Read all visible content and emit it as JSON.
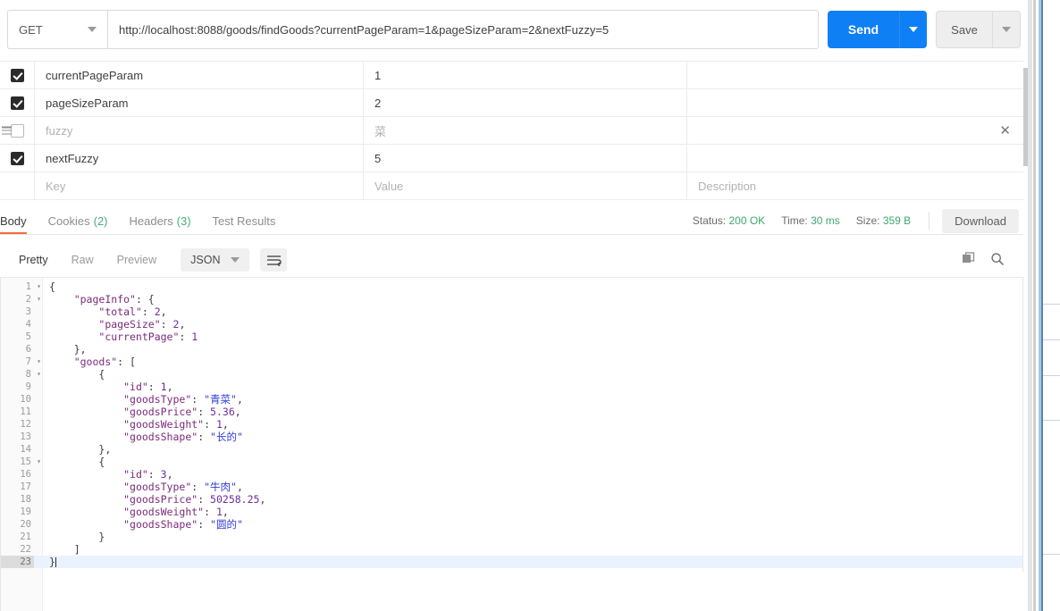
{
  "request": {
    "method": "GET",
    "url": "http://localhost:8088/goods/findGoods?currentPageParam=1&pageSizeParam=2&nextFuzzy=5",
    "send_label": "Send",
    "save_label": "Save"
  },
  "params": {
    "placeholder_key": "Key",
    "placeholder_value": "Value",
    "placeholder_description": "Description",
    "rows": [
      {
        "checked": true,
        "key": "currentPageParam",
        "value": "1",
        "description": "",
        "removable": false
      },
      {
        "checked": true,
        "key": "pageSizeParam",
        "value": "2",
        "description": "",
        "removable": false
      },
      {
        "checked": false,
        "key": "fuzzy",
        "value": "菜",
        "description": "",
        "removable": true
      },
      {
        "checked": true,
        "key": "nextFuzzy",
        "value": "5",
        "description": "",
        "removable": false
      }
    ]
  },
  "response": {
    "tabs": [
      {
        "label": "Body",
        "count": "",
        "active": true
      },
      {
        "label": "Cookies",
        "count": "(2)",
        "active": false
      },
      {
        "label": "Headers",
        "count": "(3)",
        "active": false
      },
      {
        "label": "Test Results",
        "count": "",
        "active": false
      }
    ],
    "status_label": "Status:",
    "status_value": "200 OK",
    "time_label": "Time:",
    "time_value": "30 ms",
    "size_label": "Size:",
    "size_value": "359 B",
    "download_label": "Download",
    "status_color": "#3fa86f"
  },
  "viewer": {
    "modes": [
      {
        "label": "Pretty",
        "active": true
      },
      {
        "label": "Raw",
        "active": false
      },
      {
        "label": "Preview",
        "active": false
      }
    ],
    "language": "JSON",
    "wrap_icon": "wrap-lines-icon",
    "copy_icon": "copy-icon",
    "search_icon": "search-icon"
  },
  "body": {
    "lines": [
      {
        "n": "1",
        "fold": "▾",
        "indent": 0,
        "segments": [
          {
            "t": "{",
            "c": "punc"
          }
        ]
      },
      {
        "n": "2",
        "fold": "▾",
        "indent": 1,
        "segments": [
          {
            "t": "\"pageInfo\"",
            "c": "key"
          },
          {
            "t": ": {",
            "c": "punc"
          }
        ]
      },
      {
        "n": "3",
        "fold": "",
        "indent": 2,
        "segments": [
          {
            "t": "\"total\"",
            "c": "key"
          },
          {
            "t": ": ",
            "c": "punc"
          },
          {
            "t": "2",
            "c": "num"
          },
          {
            "t": ",",
            "c": "punc"
          }
        ]
      },
      {
        "n": "4",
        "fold": "",
        "indent": 2,
        "segments": [
          {
            "t": "\"pageSize\"",
            "c": "key"
          },
          {
            "t": ": ",
            "c": "punc"
          },
          {
            "t": "2",
            "c": "num"
          },
          {
            "t": ",",
            "c": "punc"
          }
        ]
      },
      {
        "n": "5",
        "fold": "",
        "indent": 2,
        "segments": [
          {
            "t": "\"currentPage\"",
            "c": "key"
          },
          {
            "t": ": ",
            "c": "punc"
          },
          {
            "t": "1",
            "c": "num"
          }
        ]
      },
      {
        "n": "6",
        "fold": "",
        "indent": 1,
        "segments": [
          {
            "t": "},",
            "c": "punc"
          }
        ]
      },
      {
        "n": "7",
        "fold": "▾",
        "indent": 1,
        "segments": [
          {
            "t": "\"goods\"",
            "c": "key"
          },
          {
            "t": ": [",
            "c": "punc"
          }
        ]
      },
      {
        "n": "8",
        "fold": "▾",
        "indent": 2,
        "segments": [
          {
            "t": "{",
            "c": "punc"
          }
        ]
      },
      {
        "n": "9",
        "fold": "",
        "indent": 3,
        "segments": [
          {
            "t": "\"id\"",
            "c": "key"
          },
          {
            "t": ": ",
            "c": "punc"
          },
          {
            "t": "1",
            "c": "num"
          },
          {
            "t": ",",
            "c": "punc"
          }
        ]
      },
      {
        "n": "10",
        "fold": "",
        "indent": 3,
        "segments": [
          {
            "t": "\"goodsType\"",
            "c": "key"
          },
          {
            "t": ": ",
            "c": "punc"
          },
          {
            "t": "\"青菜\"",
            "c": "str"
          },
          {
            "t": ",",
            "c": "punc"
          }
        ]
      },
      {
        "n": "11",
        "fold": "",
        "indent": 3,
        "segments": [
          {
            "t": "\"goodsPrice\"",
            "c": "key"
          },
          {
            "t": ": ",
            "c": "punc"
          },
          {
            "t": "5.36",
            "c": "num"
          },
          {
            "t": ",",
            "c": "punc"
          }
        ]
      },
      {
        "n": "12",
        "fold": "",
        "indent": 3,
        "segments": [
          {
            "t": "\"goodsWeight\"",
            "c": "key"
          },
          {
            "t": ": ",
            "c": "punc"
          },
          {
            "t": "1",
            "c": "num"
          },
          {
            "t": ",",
            "c": "punc"
          }
        ]
      },
      {
        "n": "13",
        "fold": "",
        "indent": 3,
        "segments": [
          {
            "t": "\"goodsShape\"",
            "c": "key"
          },
          {
            "t": ": ",
            "c": "punc"
          },
          {
            "t": "\"长的\"",
            "c": "str"
          }
        ]
      },
      {
        "n": "14",
        "fold": "",
        "indent": 2,
        "segments": [
          {
            "t": "},",
            "c": "punc"
          }
        ]
      },
      {
        "n": "15",
        "fold": "▾",
        "indent": 2,
        "segments": [
          {
            "t": "{",
            "c": "punc"
          }
        ]
      },
      {
        "n": "16",
        "fold": "",
        "indent": 3,
        "segments": [
          {
            "t": "\"id\"",
            "c": "key"
          },
          {
            "t": ": ",
            "c": "punc"
          },
          {
            "t": "3",
            "c": "num"
          },
          {
            "t": ",",
            "c": "punc"
          }
        ]
      },
      {
        "n": "17",
        "fold": "",
        "indent": 3,
        "segments": [
          {
            "t": "\"goodsType\"",
            "c": "key"
          },
          {
            "t": ": ",
            "c": "punc"
          },
          {
            "t": "\"牛肉\"",
            "c": "str"
          },
          {
            "t": ",",
            "c": "punc"
          }
        ]
      },
      {
        "n": "18",
        "fold": "",
        "indent": 3,
        "segments": [
          {
            "t": "\"goodsPrice\"",
            "c": "key"
          },
          {
            "t": ": ",
            "c": "punc"
          },
          {
            "t": "50258.25",
            "c": "num"
          },
          {
            "t": ",",
            "c": "punc"
          }
        ]
      },
      {
        "n": "19",
        "fold": "",
        "indent": 3,
        "segments": [
          {
            "t": "\"goodsWeight\"",
            "c": "key"
          },
          {
            "t": ": ",
            "c": "punc"
          },
          {
            "t": "1",
            "c": "num"
          },
          {
            "t": ",",
            "c": "punc"
          }
        ]
      },
      {
        "n": "20",
        "fold": "",
        "indent": 3,
        "segments": [
          {
            "t": "\"goodsShape\"",
            "c": "key"
          },
          {
            "t": ": ",
            "c": "punc"
          },
          {
            "t": "\"圆的\"",
            "c": "str"
          }
        ]
      },
      {
        "n": "21",
        "fold": "",
        "indent": 2,
        "segments": [
          {
            "t": "}",
            "c": "punc"
          }
        ]
      },
      {
        "n": "22",
        "fold": "",
        "indent": 1,
        "segments": [
          {
            "t": "]",
            "c": "punc"
          }
        ]
      },
      {
        "n": "23",
        "fold": "",
        "indent": 0,
        "active": true,
        "caret": true,
        "segments": [
          {
            "t": "}",
            "c": "punc"
          }
        ]
      }
    ]
  }
}
